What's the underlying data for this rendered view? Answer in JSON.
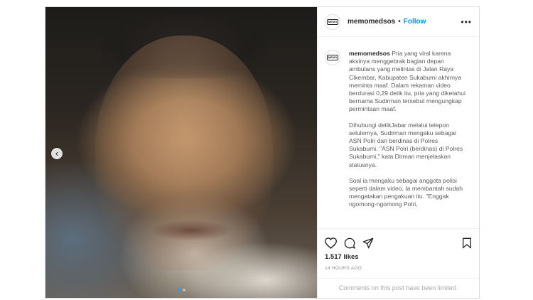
{
  "post": {
    "username": "memomedsos",
    "separator": "•",
    "follow_label": "Follow",
    "more_icon": "•••",
    "avatar_text": "MEMO",
    "caption_username": "memomedsos",
    "caption_paragraphs": [
      "Pria yang viral karena aksinya menggebrak bagian depan ambulans yang melintas di Jalan Raya Cikembar, Kabupaten Sukabumi akhirnya meminta maaf. Dalam rekaman video berdurasi 0,29 detik itu, pria yang diketahui bernama Sudirman tersebut mengungkap permintaan maaf.",
      "Dihubungi detikJabar melalui telepon selulernya, Sudirman mengaku sebagai ASN Polri dan berdinas di Polres Sukabumi. \"ASN Polri (berdinas) di Polres Sukabumi,\" kata Dirman menjelaskan statusnya.",
      "Soal ia mengaku sebagai anggota polisi seperti dalam video, Ia membantah sudah mengatakan pengakuan itu. \"Enggak ngomong-ngomong Polri,"
    ],
    "likes": "1.517 likes",
    "timestamp": "14 HOURS AGO",
    "comments_notice": "Comments on this post have been limited."
  },
  "media": {
    "prev_icon": "‹",
    "carousel_count": 2,
    "carousel_active": 1
  },
  "icons": {
    "like": "heart-icon",
    "comment": "comment-icon",
    "share": "share-icon",
    "save": "bookmark-icon"
  },
  "colors": {
    "follow_blue": "#0095f6",
    "border": "#dbdbdb",
    "muted_text": "#8e8e8e"
  }
}
